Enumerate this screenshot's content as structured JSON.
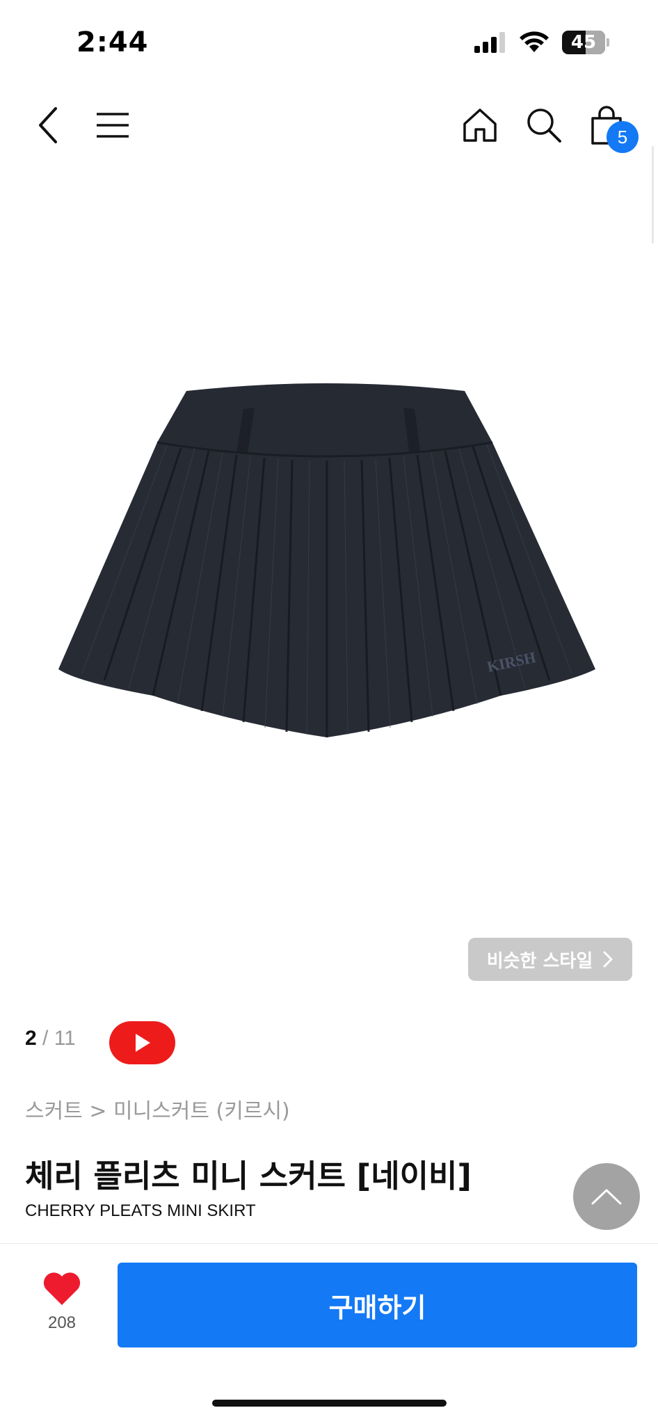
{
  "status_bar": {
    "time": "2:44",
    "battery": "45"
  },
  "nav": {
    "cart_count": "5"
  },
  "product": {
    "similar_style_label": "비슷한 스타일",
    "image_index": "2",
    "image_total": "11",
    "breadcrumb": "스커트 > 미니스커트 (키르시)",
    "title": "체리 플리츠 미니 스커트 [네이비]",
    "subtitle": "CHERRY PLEATS MINI SKIRT",
    "image_logo_text": "KIRSH"
  },
  "bottom_bar": {
    "like_count": "208",
    "buy_label": "구매하기"
  },
  "colors": {
    "accent": "#1479f5",
    "like": "#ee1b2e",
    "youtube": "#ee1b1b",
    "skirt": "#262a33"
  }
}
